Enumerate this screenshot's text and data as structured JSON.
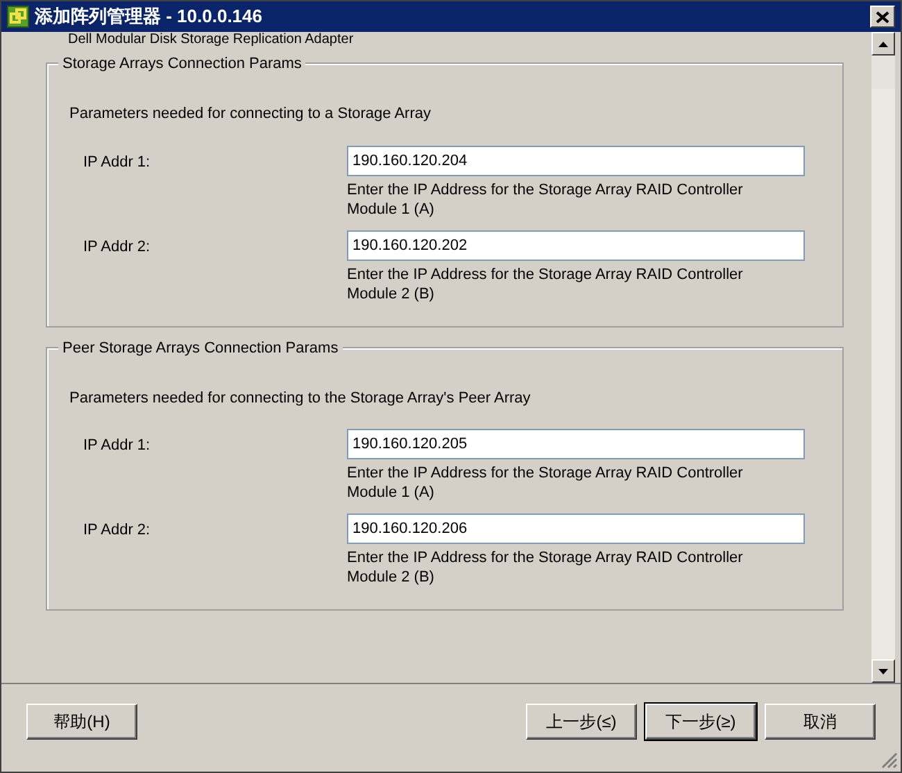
{
  "window": {
    "title": "添加阵列管理器 - 10.0.0.146"
  },
  "subtitle": "Dell Modular Disk Storage Replication Adapter",
  "groups": [
    {
      "legend": "Storage Arrays Connection Params",
      "description": "Parameters needed for connecting to a Storage Array",
      "fields": [
        {
          "label": "IP Addr 1:",
          "value": "190.160.120.204",
          "hint": "Enter the IP Address for the Storage Array RAID Controller Module 1 (A)"
        },
        {
          "label": "IP Addr 2:",
          "value": "190.160.120.202",
          "hint": "Enter the IP Address for the Storage Array RAID Controller Module 2 (B)"
        }
      ]
    },
    {
      "legend": "Peer Storage Arrays Connection Params",
      "description": "Parameters needed for connecting to the Storage Array's Peer Array",
      "fields": [
        {
          "label": "IP Addr 1:",
          "value": "190.160.120.205",
          "hint": "Enter the IP Address for the Storage Array RAID Controller Module 1 (A)"
        },
        {
          "label": "IP Addr 2:",
          "value": "190.160.120.206",
          "hint": "Enter the IP Address for the Storage Array RAID Controller Module 2 (B)"
        }
      ]
    }
  ],
  "buttons": [
    {
      "label": "帮助(H)",
      "default": false
    },
    {
      "label": "上一步(≤)",
      "default": false
    },
    {
      "label": "下一步(≥)",
      "default": true
    },
    {
      "label": "取消",
      "default": false
    }
  ]
}
